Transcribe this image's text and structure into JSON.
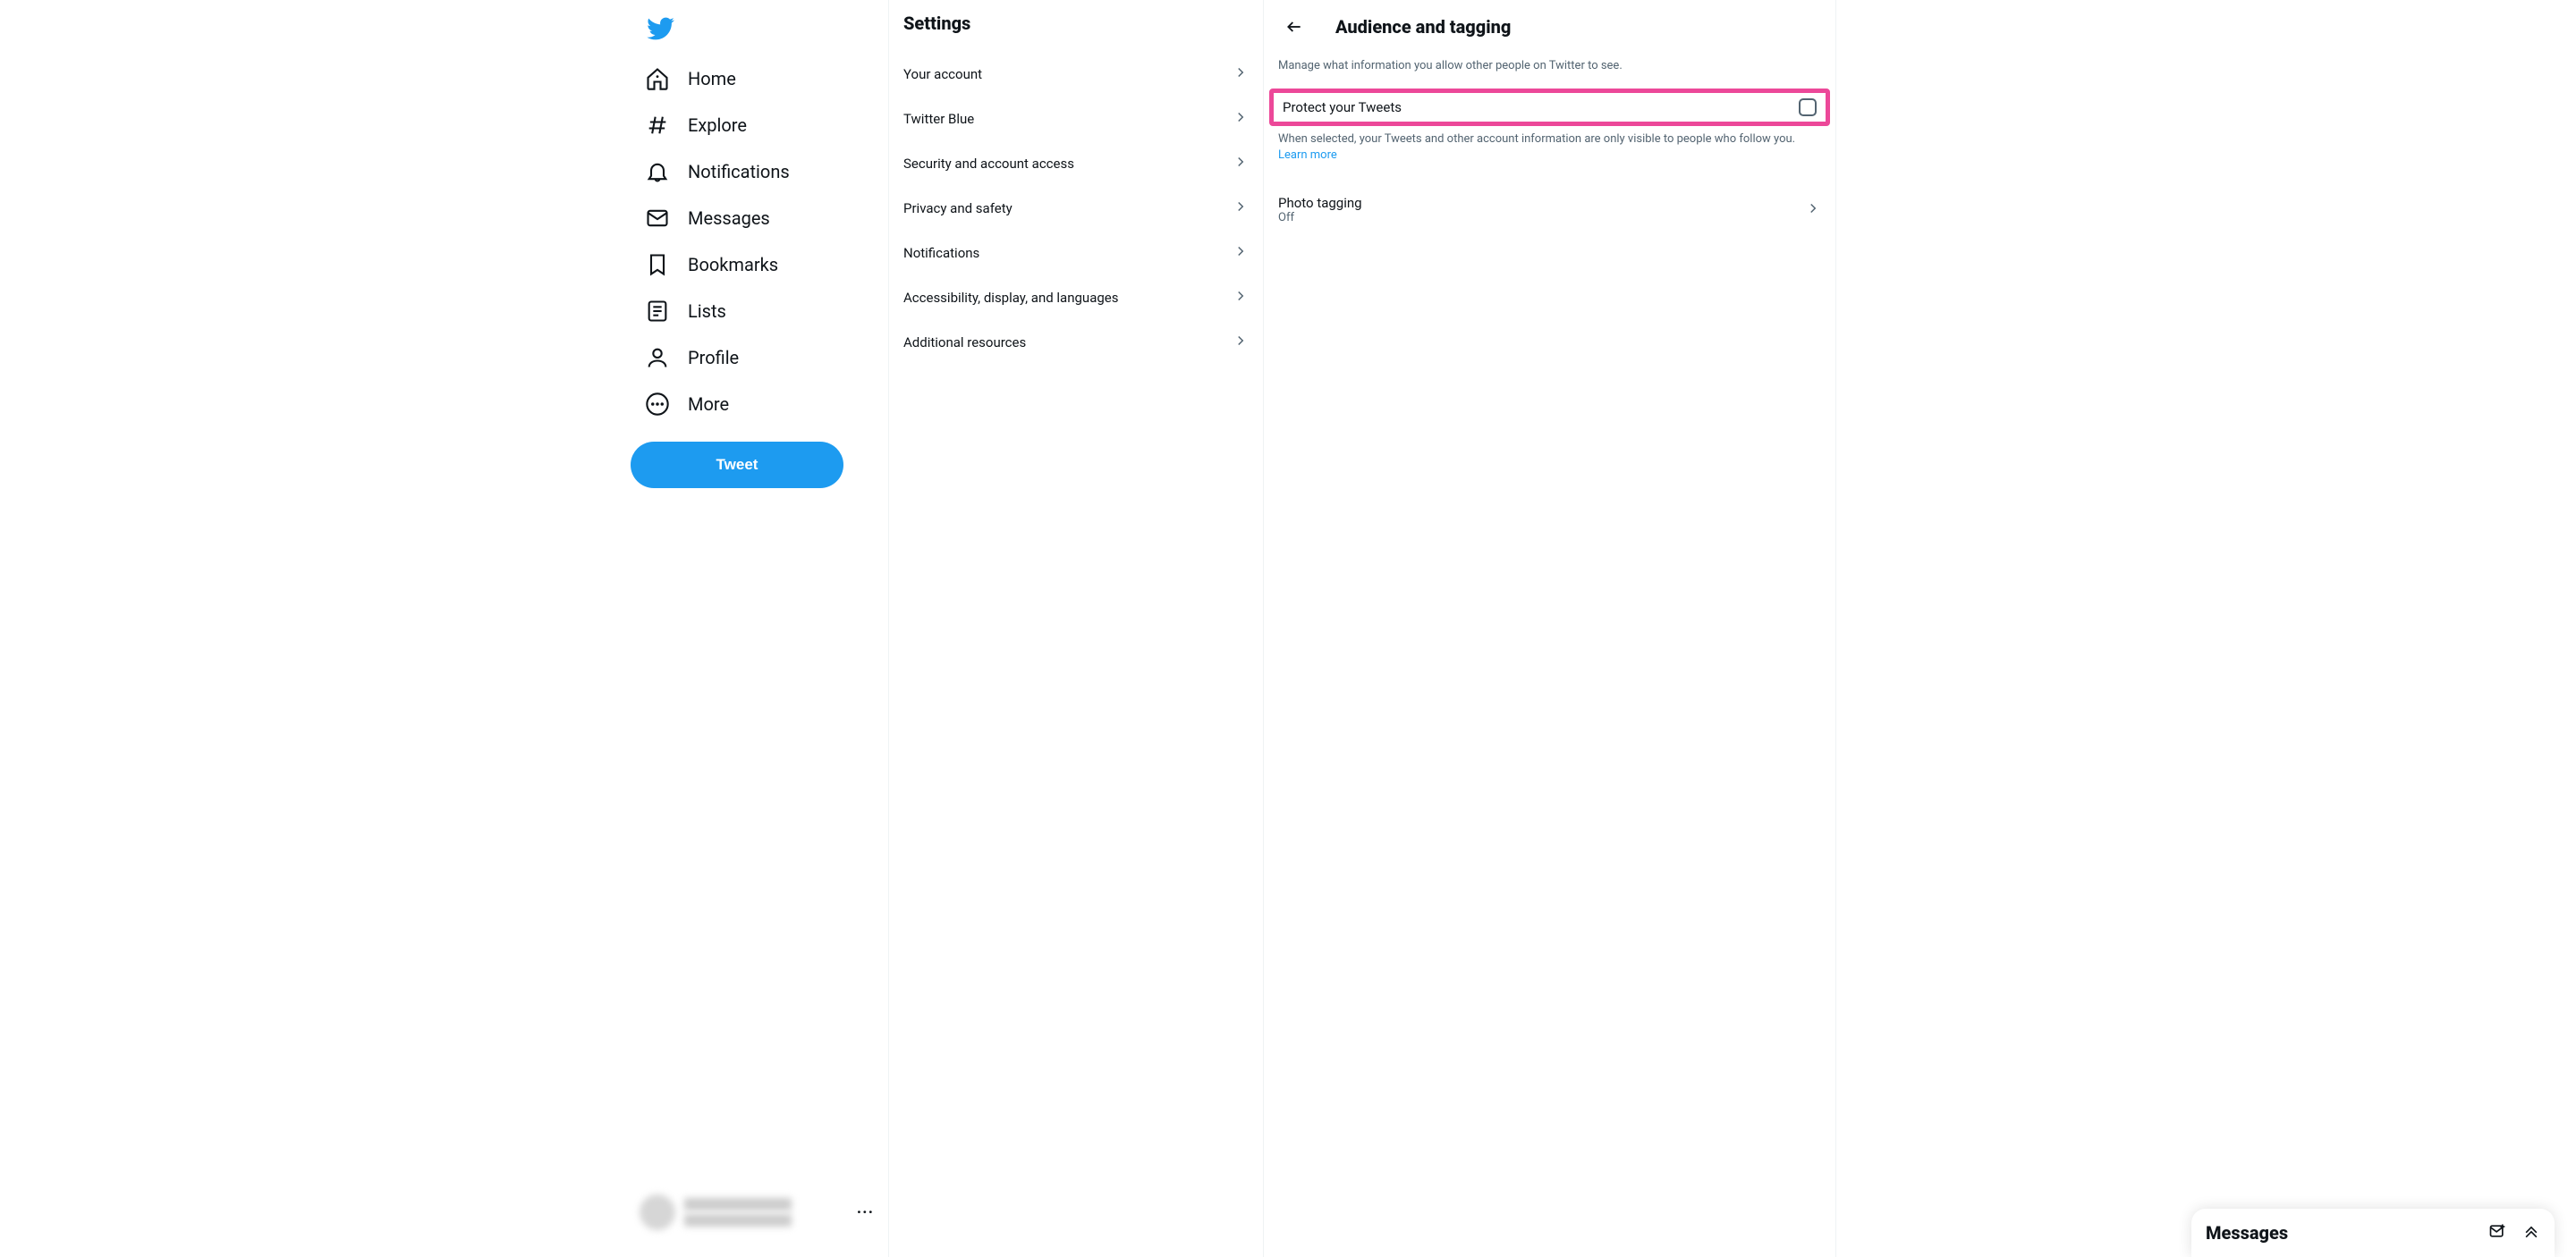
{
  "nav": {
    "items": [
      {
        "label": "Home"
      },
      {
        "label": "Explore"
      },
      {
        "label": "Notifications"
      },
      {
        "label": "Messages"
      },
      {
        "label": "Bookmarks"
      },
      {
        "label": "Lists"
      },
      {
        "label": "Profile"
      },
      {
        "label": "More"
      }
    ],
    "tweet_label": "Tweet"
  },
  "settings": {
    "title": "Settings",
    "items": [
      {
        "label": "Your account"
      },
      {
        "label": "Twitter Blue"
      },
      {
        "label": "Security and account access"
      },
      {
        "label": "Privacy and safety"
      },
      {
        "label": "Notifications"
      },
      {
        "label": "Accessibility, display, and languages"
      },
      {
        "label": "Additional resources"
      }
    ]
  },
  "detail": {
    "title": "Audience and tagging",
    "subtitle": "Manage what information you allow other people on Twitter to see.",
    "protect_label": "Protect your Tweets",
    "protect_desc_prefix": "When selected, your Tweets and other account information are only visible to people who follow you. ",
    "learn_more_label": "Learn more",
    "photo_tagging_label": "Photo tagging",
    "photo_tagging_value": "Off"
  },
  "messages_dock": {
    "title": "Messages"
  }
}
